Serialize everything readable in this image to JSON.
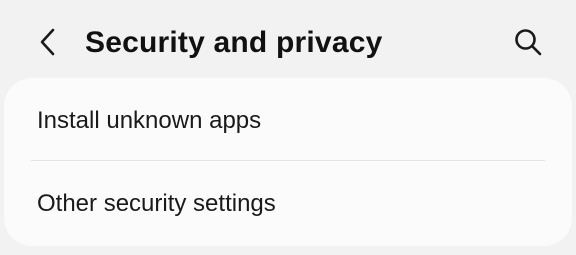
{
  "header": {
    "title": "Security and privacy",
    "back_icon": "chevron-left-icon",
    "search_icon": "search-icon"
  },
  "list": {
    "items": [
      {
        "label": "Install unknown apps"
      },
      {
        "label": "Other security settings"
      }
    ]
  },
  "colors": {
    "background": "#f2f2f2",
    "card": "#fbfbfb",
    "text": "#1a1a1a",
    "divider": "#e4e4e4"
  }
}
